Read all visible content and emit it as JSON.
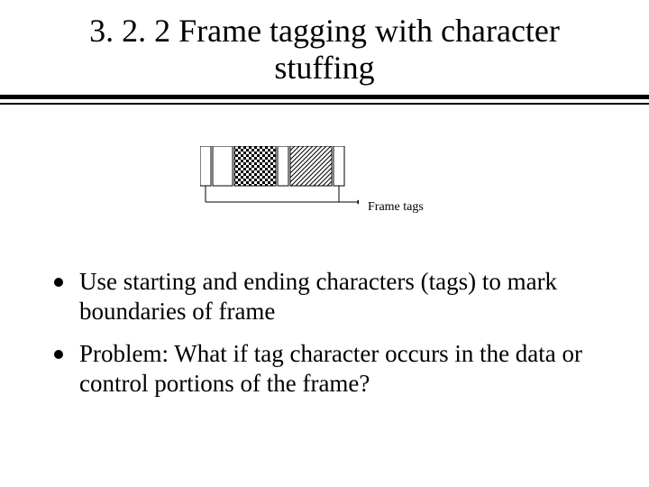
{
  "title": "3. 2. 2 Frame tagging with character stuffing",
  "diagram_label": "Frame tags",
  "bullets": [
    "Use starting and ending characters (tags) to mark boundaries of frame",
    "Problem: What if tag character occurs in the data or control portions of the frame?"
  ]
}
